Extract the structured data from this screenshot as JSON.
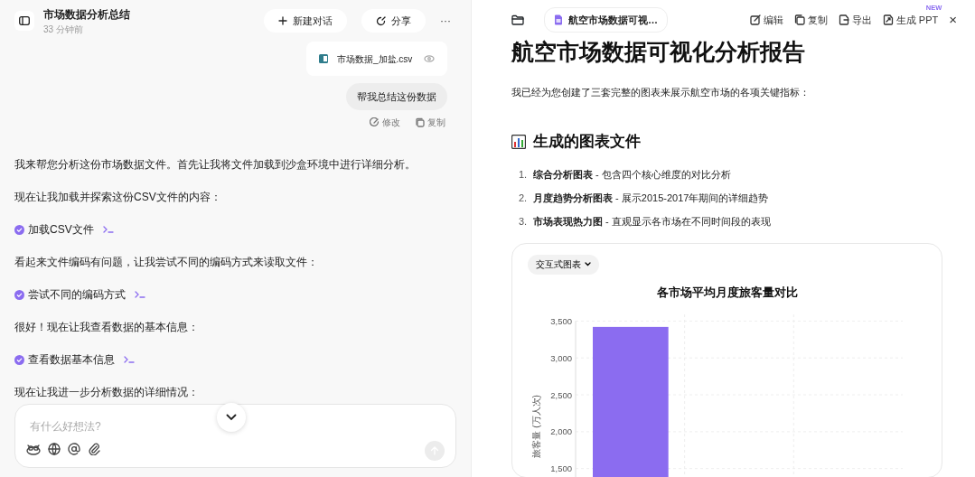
{
  "chat": {
    "title": "市场数据分析总结",
    "time": "33 分钟前",
    "new_chat": "新建对话",
    "share": "分享",
    "more": "···",
    "attachment": {
      "name": "市场数据_加盐.csv"
    },
    "user_message": "帮我总结这份数据",
    "message_actions": [
      "修改",
      "复制"
    ],
    "messages": [
      {
        "kind": "text",
        "text": "我来帮您分析这份市场数据文件。首先让我将文件加载到沙盒环境中进行详细分析。"
      },
      {
        "kind": "text",
        "text": "现在让我加载并探索这份CSV文件的内容："
      },
      {
        "kind": "step",
        "text": "加载CSV文件"
      },
      {
        "kind": "text",
        "text": "看起来文件编码有问题，让我尝试不同的编码方式来读取文件："
      },
      {
        "kind": "step",
        "text": "尝试不同的编码方式"
      },
      {
        "kind": "text",
        "text": "很好！现在让我查看数据的基本信息："
      },
      {
        "kind": "step",
        "text": "查看数据基本信息"
      },
      {
        "kind": "text",
        "text": "现在让我进一步分析数据的详细情况："
      }
    ],
    "input": {
      "placeholder": "有什么好想法?"
    }
  },
  "document": {
    "tab": "航空市场数据可视…",
    "actions": [
      {
        "kind": "edit",
        "label": "编辑"
      },
      {
        "kind": "copy",
        "label": "复制"
      },
      {
        "kind": "export",
        "label": "导出"
      },
      {
        "kind": "ppt",
        "label": "生成 PPT",
        "badge": "NEW"
      }
    ],
    "close": "×",
    "heading": "航空市场数据可视化分析报告",
    "intro": "我已经为您创建了三套完整的图表来展示航空市场的各项关键指标：",
    "section_title": "生成的图表文件",
    "list": [
      {
        "number": "1.",
        "text": "**综合分析图表** - 包含四个核心维度的对比分析"
      },
      {
        "number": "2.",
        "text": "**月度趋势分析图表** - 展示2015-2017年期间的详细趋势"
      },
      {
        "number": "3.",
        "text": "**市场表现热力图** - 直观显示各市场在不同时间段的表现"
      }
    ],
    "chart_selector": "交互式图表",
    "chart_data": {
      "type": "bar",
      "title": "各市场平均月度旅客量对比",
      "ylabel": "旅客量 (万人次)",
      "series": [
        {
          "color": "#8b6cf0",
          "values": [
            3420,
            null,
            null
          ]
        }
      ],
      "grid": true,
      "ylim": [
        1190,
        3590
      ],
      "yticks": [
        {
          "value": 1500,
          "label": "1,500"
        },
        {
          "value": 2000,
          "label": "2,000"
        },
        {
          "value": 2500,
          "label": "2,500"
        },
        {
          "value": 3000,
          "label": "3,000"
        },
        {
          "value": 3500,
          "label": "3,500"
        }
      ]
    }
  }
}
